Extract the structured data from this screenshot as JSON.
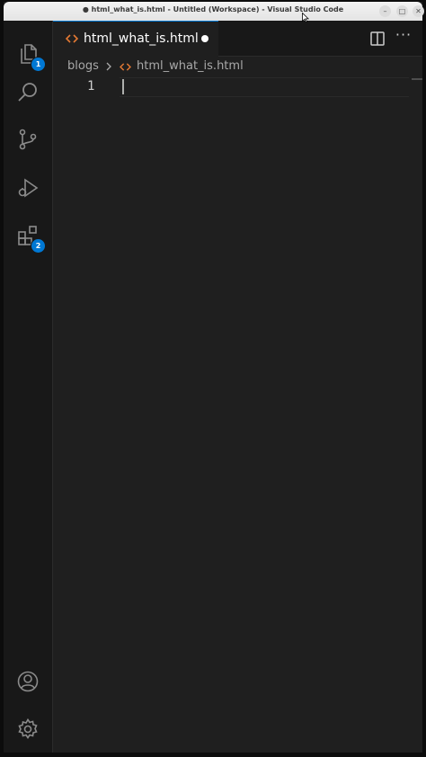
{
  "window": {
    "title": "● html_what_is.html - Untitled (Workspace) - Visual Studio Code",
    "buttons": {
      "minimize": "–",
      "maximize": "□",
      "close": "✕"
    }
  },
  "activity_bar": {
    "items": [
      {
        "id": "explorer",
        "icon": "files-icon",
        "badge": "1"
      },
      {
        "id": "search",
        "icon": "search-icon"
      },
      {
        "id": "source-control",
        "icon": "source-control-icon"
      },
      {
        "id": "run-debug",
        "icon": "run-debug-icon"
      },
      {
        "id": "extensions",
        "icon": "extensions-icon",
        "badge": "2"
      }
    ],
    "bottom": [
      {
        "id": "accounts",
        "icon": "account-icon"
      },
      {
        "id": "manage",
        "icon": "gear-icon"
      }
    ]
  },
  "tabs": [
    {
      "label": "html_what_is.html",
      "icon": "html-code-icon",
      "modified": true,
      "active": true
    }
  ],
  "editor_actions": {
    "more": "···"
  },
  "breadcrumb": {
    "folder": "blogs",
    "file": "html_what_is.html"
  },
  "editor": {
    "lines": [
      {
        "number": "1",
        "text": ""
      }
    ]
  },
  "colors": {
    "accent": "#0078d4",
    "badge": "#0078d4",
    "html_icon": "#e37933",
    "editor_bg": "#1f1f1f",
    "activity_bg": "#181818"
  }
}
